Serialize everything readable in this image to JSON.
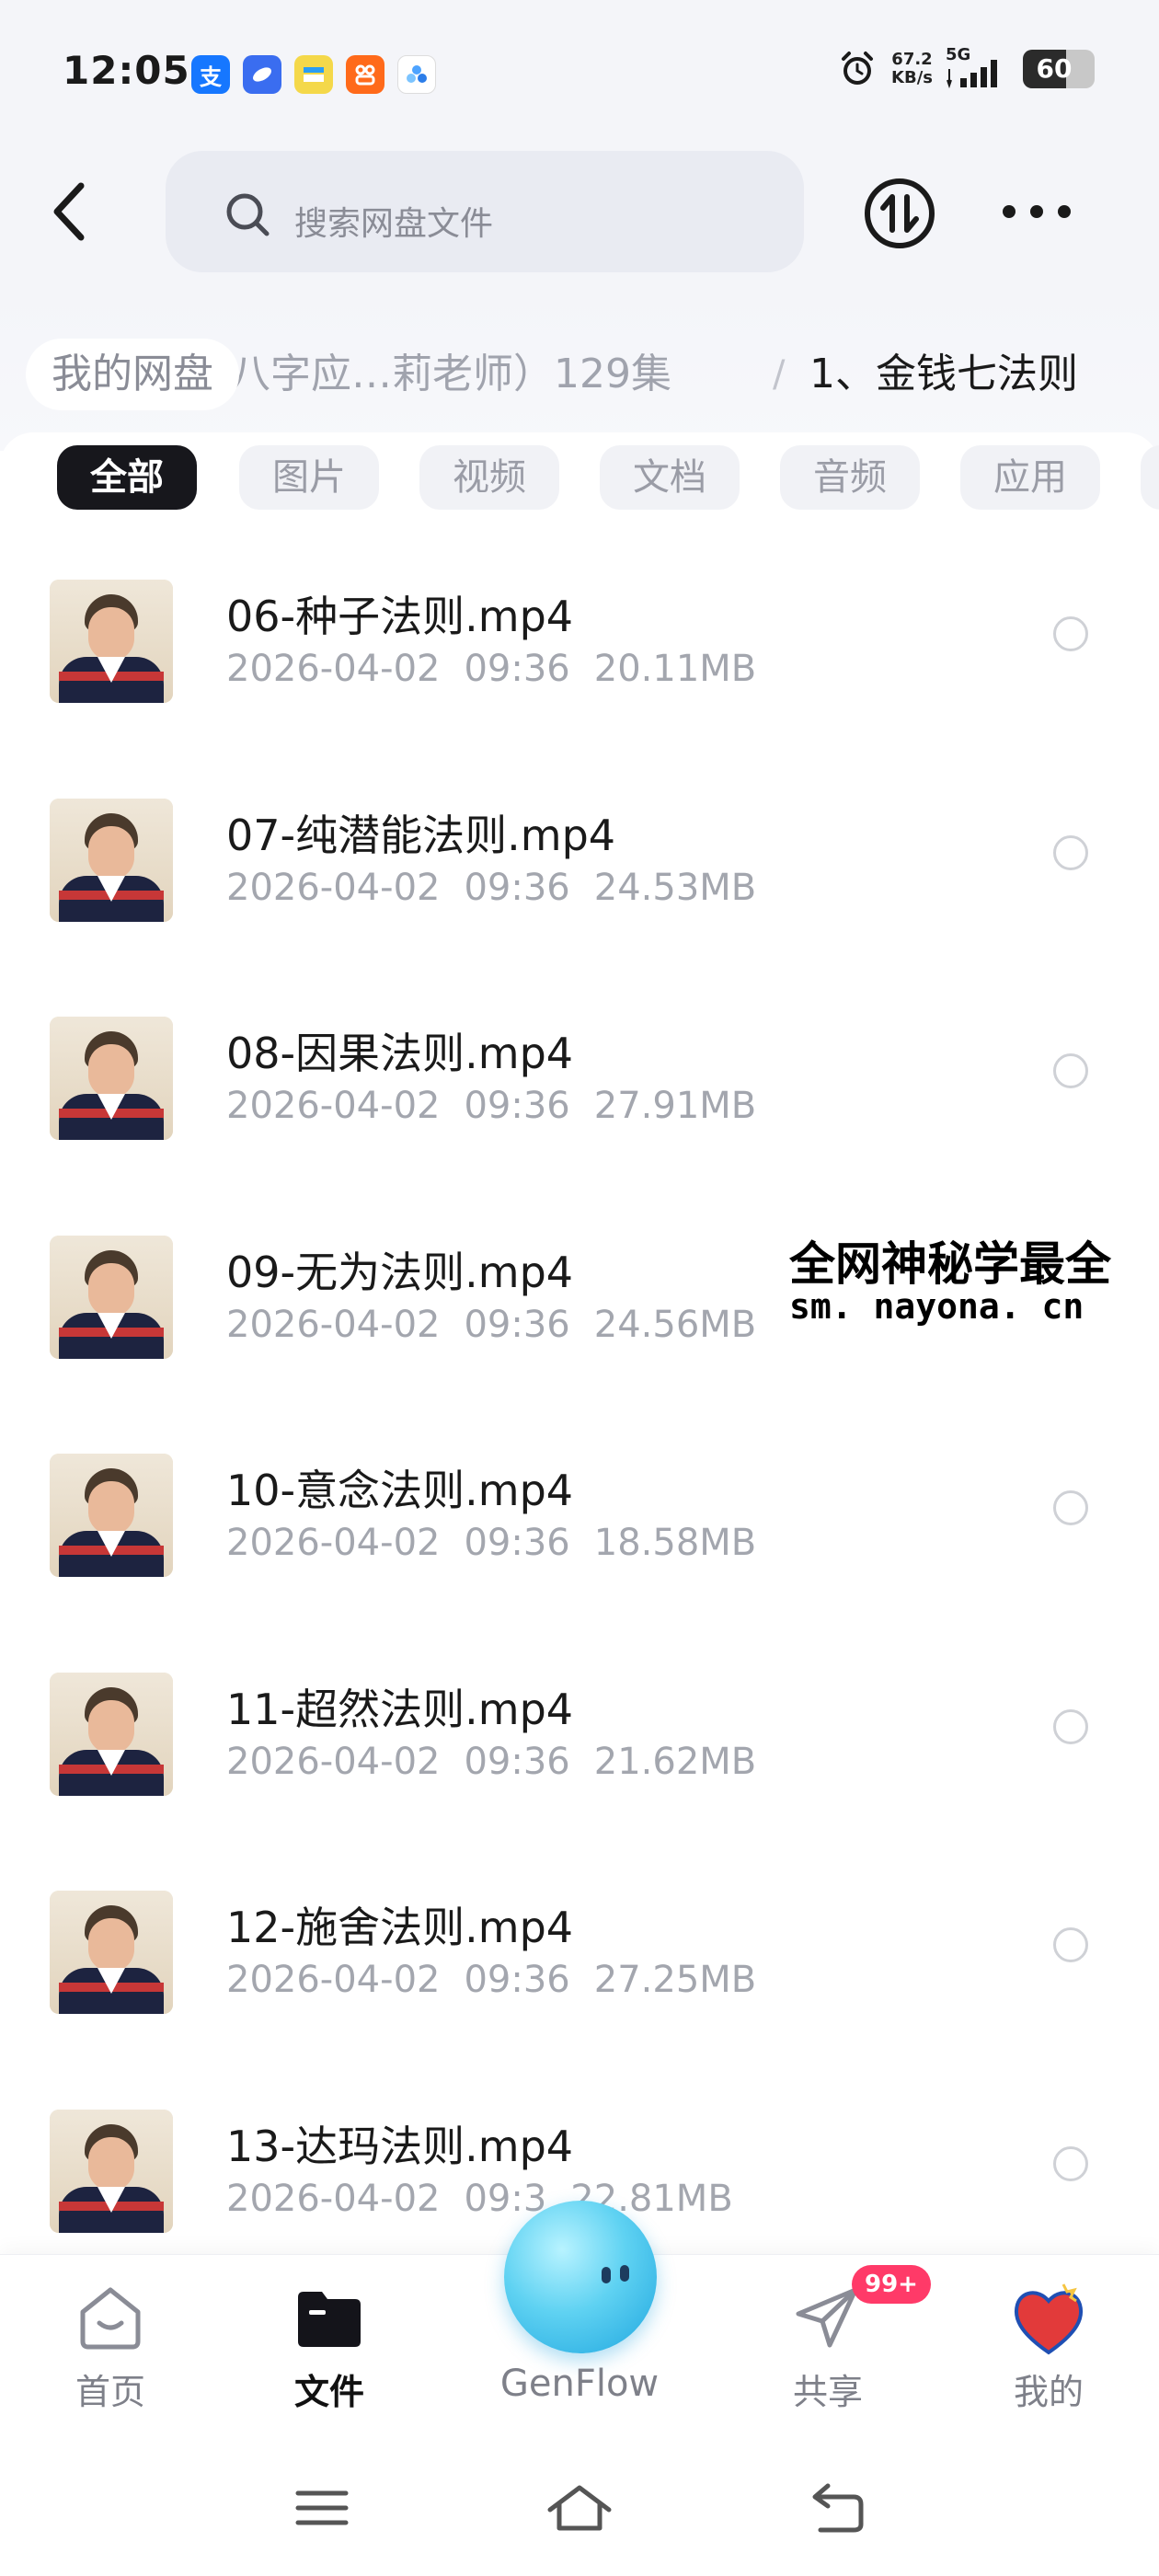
{
  "status_bar": {
    "time": "12:05",
    "network_speed_value": "67.2",
    "network_speed_unit": "KB/s",
    "network_type": "5G",
    "battery_level": "60",
    "battery_fraction": 0.6,
    "app_icons": [
      "alipay-icon",
      "app-icon-blue",
      "app-icon-yellow",
      "taobao-icon",
      "genflow-status-icon"
    ]
  },
  "header": {
    "search_placeholder": "搜索网盘文件"
  },
  "breadcrumb": {
    "root": "我的网盘",
    "middle": "八字应…莉老师）129集",
    "separator": "/",
    "current": "1、金钱七法则"
  },
  "filters": {
    "items": [
      "全部",
      "图片",
      "视频",
      "文档",
      "音频",
      "应用"
    ],
    "active_index": 0
  },
  "files": [
    {
      "name": "06-种子法则.mp4",
      "date": "2026-04-02",
      "time": "09:36",
      "size": "20.11MB"
    },
    {
      "name": "07-纯潜能法则.mp4",
      "date": "2026-04-02",
      "time": "09:36",
      "size": "24.53MB"
    },
    {
      "name": "08-因果法则.mp4",
      "date": "2026-04-02",
      "time": "09:36",
      "size": "27.91MB"
    },
    {
      "name": "09-无为法则.mp4",
      "date": "2026-04-02",
      "time": "09:36",
      "size": "24.56MB"
    },
    {
      "name": "10-意念法则.mp4",
      "date": "2026-04-02",
      "time": "09:36",
      "size": "18.58MB"
    },
    {
      "name": "11-超然法则.mp4",
      "date": "2026-04-02",
      "time": "09:36",
      "size": "21.62MB"
    },
    {
      "name": "12-施舍法则.mp4",
      "date": "2026-04-02",
      "time": "09:36",
      "size": "27.25MB"
    },
    {
      "name": "13-达玛法则.mp4",
      "date": "2026-04-02",
      "time": "09:3",
      "size": "22.81MB"
    }
  ],
  "watermark": {
    "line1": "全网神秘学最全",
    "line2": "sm. nayona. cn"
  },
  "bottom_nav": {
    "home": "首页",
    "files": "文件",
    "genflow": "GenFlow",
    "share": "共享",
    "share_badge": "99+",
    "mine": "我的"
  },
  "colors": {
    "background": "#f4f5f9",
    "active_tab": "#17171c",
    "badge": "#ff3a68",
    "genflow": "#1fa6df"
  }
}
